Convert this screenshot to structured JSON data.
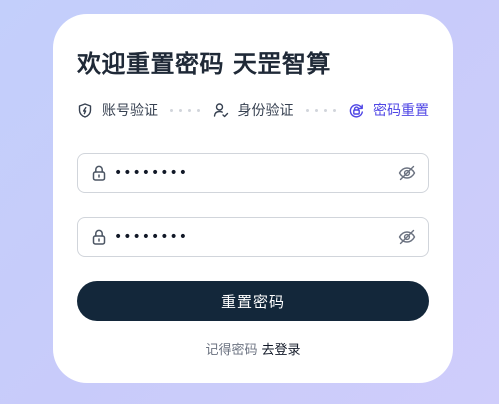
{
  "title": "欢迎重置密码 天罡智算",
  "steps": [
    {
      "label": "账号验证",
      "icon": "shield-icon",
      "state": "done"
    },
    {
      "label": "身份验证",
      "icon": "user-check-icon",
      "state": "done"
    },
    {
      "label": "密码重置",
      "icon": "reset-icon",
      "state": "active"
    }
  ],
  "fields": [
    {
      "value": "••••••••",
      "icon": "lock-icon",
      "toggle_icon": "eye-off-icon"
    },
    {
      "value": "••••••••",
      "icon": "lock-icon",
      "toggle_icon": "eye-off-icon"
    }
  ],
  "submit_label": "重置密码",
  "footer": {
    "remember_text": "记得密码",
    "login_link": "去登录"
  },
  "colors": {
    "accent": "#4f46e5",
    "button": "#13273a",
    "background": "#c8cbfa"
  }
}
